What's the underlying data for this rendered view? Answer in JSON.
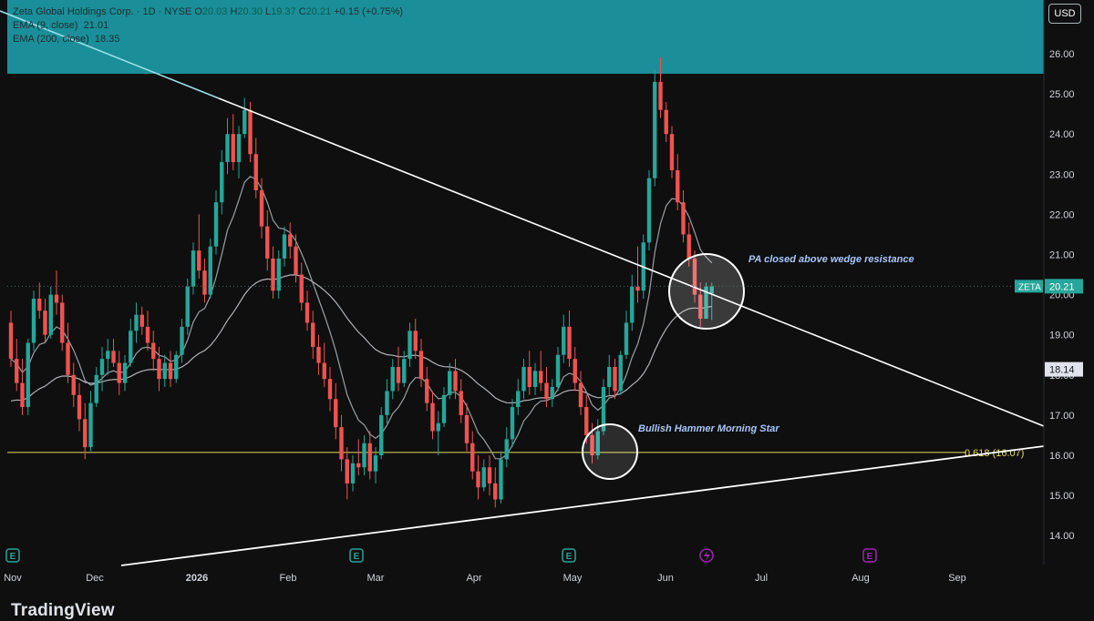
{
  "header": {
    "title": "Zeta Global Holdings Corp. · 1D · NYSE",
    "ohlc": [
      {
        "k": "O",
        "v": "20.03"
      },
      {
        "k": "H",
        "v": "20.30"
      },
      {
        "k": "L",
        "v": "19.37"
      },
      {
        "k": "C",
        "v": "20.21"
      }
    ],
    "change": "+0.15 (+0.75%)",
    "indicators": [
      {
        "label": "EMA (9, close)",
        "value": "21.01"
      },
      {
        "label": "EMA (200, close)",
        "value": "18.35"
      }
    ],
    "currency_button": "USD",
    "brand": "TradingView"
  },
  "chart_data": {
    "type": "candlestick",
    "symbol": "ZETA",
    "last_price": "20.21",
    "ema200_label": "18.14",
    "ylim": [
      13.3,
      26.6
    ],
    "y_ticks": [
      "26.00",
      "25.00",
      "24.00",
      "23.00",
      "22.00",
      "21.00",
      "20.00",
      "19.00",
      "18.00",
      "17.00",
      "16.00",
      "15.00",
      "14.00"
    ],
    "x_ticks": [
      "Nov",
      "Dec",
      "2026",
      "Feb",
      "Mar",
      "Apr",
      "May",
      "Jun",
      "Jul",
      "Aug",
      "Sep"
    ],
    "fib_level": {
      "label": "0.618 (16.07)",
      "value": 16.07
    },
    "annotations": [
      "PA closed above wedge resistance",
      "Bullish Hammer Morning Star"
    ],
    "colors": {
      "up": "#26a69a",
      "down": "#ef5350",
      "banner": "#1a8f99",
      "fib": "#e8dd5a",
      "lines": "#ffffff",
      "event": "#26a69a",
      "event_future": "#9c27b0"
    },
    "candles": [
      [
        19.3,
        19.6,
        18.2,
        18.4
      ],
      [
        18.4,
        18.9,
        17.6,
        17.8
      ],
      [
        17.8,
        18.4,
        17.0,
        17.2
      ],
      [
        17.2,
        18.9,
        17.0,
        18.8
      ],
      [
        18.8,
        20.1,
        18.6,
        19.9
      ],
      [
        19.9,
        20.3,
        19.4,
        19.6
      ],
      [
        19.6,
        19.9,
        18.8,
        19.0
      ],
      [
        19.0,
        20.2,
        18.9,
        20.0
      ],
      [
        20.0,
        20.6,
        19.5,
        19.8
      ],
      [
        19.8,
        20.0,
        18.6,
        18.8
      ],
      [
        18.8,
        19.3,
        17.8,
        18.0
      ],
      [
        18.0,
        18.3,
        17.2,
        17.5
      ],
      [
        17.5,
        17.8,
        16.6,
        16.9
      ],
      [
        16.9,
        17.3,
        15.9,
        16.2
      ],
      [
        16.2,
        17.6,
        16.1,
        17.3
      ],
      [
        17.3,
        18.2,
        17.2,
        18.0
      ],
      [
        18.0,
        18.7,
        17.6,
        18.4
      ],
      [
        18.4,
        18.9,
        18.0,
        18.6
      ],
      [
        18.6,
        18.9,
        18.2,
        18.3
      ],
      [
        18.3,
        18.6,
        17.5,
        17.8
      ],
      [
        17.8,
        18.5,
        17.6,
        18.3
      ],
      [
        18.3,
        19.4,
        18.2,
        19.1
      ],
      [
        19.1,
        19.8,
        18.8,
        19.5
      ],
      [
        19.5,
        19.7,
        19.0,
        19.2
      ],
      [
        19.2,
        19.6,
        18.6,
        18.8
      ],
      [
        18.8,
        19.1,
        18.1,
        18.4
      ],
      [
        18.4,
        18.7,
        17.6,
        17.9
      ],
      [
        17.9,
        18.5,
        17.7,
        18.3
      ],
      [
        18.3,
        18.6,
        17.7,
        17.9
      ],
      [
        17.9,
        18.6,
        17.8,
        18.5
      ],
      [
        18.5,
        19.4,
        18.3,
        19.2
      ],
      [
        19.2,
        20.4,
        19.0,
        20.2
      ],
      [
        20.2,
        21.3,
        20.0,
        21.1
      ],
      [
        21.1,
        22.0,
        20.4,
        20.6
      ],
      [
        20.6,
        20.9,
        19.8,
        20.0
      ],
      [
        20.0,
        21.4,
        19.9,
        21.2
      ],
      [
        21.2,
        22.6,
        21.0,
        22.3
      ],
      [
        22.3,
        23.6,
        22.0,
        23.3
      ],
      [
        23.3,
        24.4,
        23.0,
        24.0
      ],
      [
        24.0,
        24.5,
        23.1,
        23.3
      ],
      [
        23.3,
        24.2,
        22.9,
        24.0
      ],
      [
        24.0,
        24.9,
        23.9,
        24.6
      ],
      [
        24.6,
        24.8,
        23.3,
        23.5
      ],
      [
        23.5,
        23.9,
        22.4,
        22.6
      ],
      [
        22.6,
        22.9,
        21.4,
        21.7
      ],
      [
        21.7,
        22.1,
        20.6,
        20.9
      ],
      [
        20.9,
        21.2,
        19.9,
        20.1
      ],
      [
        20.1,
        21.1,
        19.9,
        20.9
      ],
      [
        20.9,
        21.7,
        20.7,
        21.5
      ],
      [
        21.5,
        21.8,
        20.9,
        21.2
      ],
      [
        21.2,
        21.5,
        20.3,
        20.5
      ],
      [
        20.5,
        20.8,
        19.6,
        19.8
      ],
      [
        19.8,
        20.1,
        19.1,
        19.3
      ],
      [
        19.3,
        19.6,
        18.4,
        18.7
      ],
      [
        18.7,
        19.0,
        18.0,
        18.3
      ],
      [
        18.3,
        18.8,
        17.7,
        17.9
      ],
      [
        17.9,
        18.2,
        17.1,
        17.4
      ],
      [
        17.4,
        17.8,
        16.4,
        16.7
      ],
      [
        16.7,
        17.0,
        15.6,
        15.9
      ],
      [
        15.9,
        16.2,
        14.9,
        15.3
      ],
      [
        15.3,
        16.0,
        15.1,
        15.8
      ],
      [
        15.8,
        16.4,
        15.5,
        15.7
      ],
      [
        15.7,
        16.5,
        15.5,
        16.3
      ],
      [
        16.3,
        16.6,
        15.4,
        15.6
      ],
      [
        15.6,
        16.2,
        15.3,
        16.0
      ],
      [
        16.0,
        17.2,
        15.9,
        17.0
      ],
      [
        17.0,
        17.9,
        16.8,
        17.6
      ],
      [
        17.6,
        18.4,
        17.4,
        18.2
      ],
      [
        18.2,
        18.7,
        17.6,
        17.8
      ],
      [
        17.8,
        18.6,
        17.7,
        18.4
      ],
      [
        18.4,
        19.3,
        18.2,
        19.1
      ],
      [
        19.1,
        19.4,
        18.4,
        18.6
      ],
      [
        18.6,
        18.9,
        17.7,
        17.9
      ],
      [
        17.9,
        18.2,
        17.1,
        17.3
      ],
      [
        17.3,
        17.6,
        16.4,
        16.6
      ],
      [
        16.6,
        17.1,
        16.0,
        16.8
      ],
      [
        16.8,
        17.7,
        16.7,
        17.5
      ],
      [
        17.5,
        18.3,
        17.4,
        18.1
      ],
      [
        18.1,
        18.4,
        17.4,
        17.6
      ],
      [
        17.6,
        17.9,
        16.8,
        17.0
      ],
      [
        17.0,
        17.3,
        16.1,
        16.3
      ],
      [
        16.3,
        16.6,
        15.4,
        15.6
      ],
      [
        15.6,
        16.0,
        14.9,
        15.2
      ],
      [
        15.2,
        15.9,
        15.1,
        15.7
      ],
      [
        15.7,
        16.0,
        15.0,
        15.3
      ],
      [
        15.3,
        15.7,
        14.7,
        14.9
      ],
      [
        14.9,
        16.1,
        14.8,
        15.9
      ],
      [
        15.9,
        16.7,
        15.7,
        16.4
      ],
      [
        16.4,
        17.4,
        16.2,
        17.2
      ],
      [
        17.2,
        17.9,
        17.0,
        17.6
      ],
      [
        17.6,
        18.4,
        17.4,
        18.2
      ],
      [
        18.2,
        18.6,
        17.5,
        17.7
      ],
      [
        17.7,
        18.3,
        17.5,
        18.1
      ],
      [
        18.1,
        18.6,
        17.6,
        17.8
      ],
      [
        17.8,
        18.2,
        17.2,
        17.4
      ],
      [
        17.4,
        17.9,
        17.2,
        17.7
      ],
      [
        17.7,
        18.7,
        17.6,
        18.5
      ],
      [
        18.5,
        19.5,
        18.3,
        19.2
      ],
      [
        19.2,
        19.6,
        18.2,
        18.4
      ],
      [
        18.4,
        18.7,
        17.6,
        17.8
      ],
      [
        17.8,
        18.1,
        17.0,
        17.2
      ],
      [
        17.2,
        17.5,
        16.3,
        16.5
      ],
      [
        16.5,
        16.8,
        15.8,
        16.0
      ],
      [
        16.0,
        16.9,
        15.9,
        16.6
      ],
      [
        16.6,
        17.9,
        16.5,
        17.7
      ],
      [
        17.7,
        18.5,
        17.5,
        18.2
      ],
      [
        18.2,
        18.4,
        17.4,
        17.6
      ],
      [
        17.6,
        18.6,
        17.5,
        18.5
      ],
      [
        18.5,
        19.6,
        18.4,
        19.3
      ],
      [
        19.3,
        20.5,
        19.1,
        20.2
      ],
      [
        20.2,
        21.2,
        19.8,
        20.1
      ],
      [
        20.1,
        21.5,
        19.9,
        21.3
      ],
      [
        21.3,
        23.1,
        21.1,
        22.9
      ],
      [
        22.9,
        25.6,
        22.7,
        25.3
      ],
      [
        25.3,
        25.9,
        24.4,
        24.6
      ],
      [
        24.6,
        24.8,
        23.8,
        24.0
      ],
      [
        24.0,
        24.2,
        22.9,
        23.1
      ],
      [
        23.1,
        23.5,
        22.1,
        22.3
      ],
      [
        22.3,
        22.6,
        21.3,
        21.5
      ],
      [
        21.5,
        21.8,
        20.7,
        20.9
      ],
      [
        20.9,
        21.1,
        19.8,
        20.0
      ],
      [
        20.0,
        20.3,
        19.2,
        19.4
      ],
      [
        19.4,
        20.3,
        19.4,
        20.2
      ],
      [
        20.03,
        20.3,
        19.37,
        20.21
      ]
    ]
  }
}
